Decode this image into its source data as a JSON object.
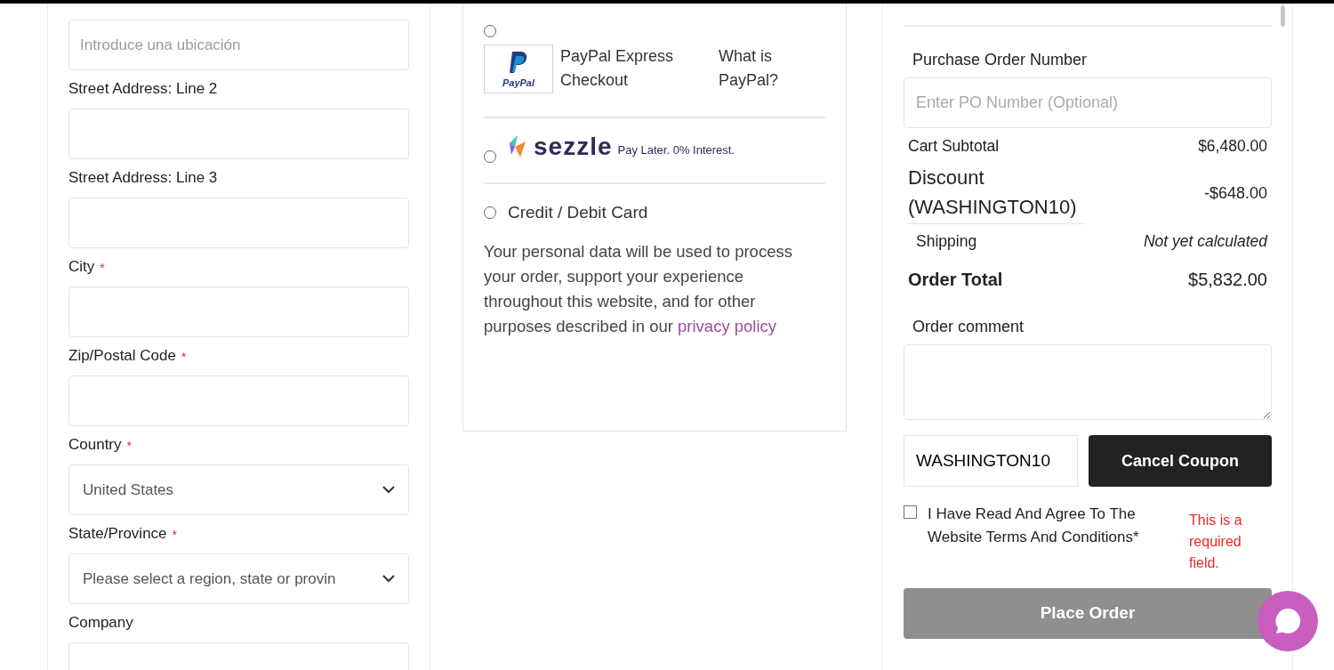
{
  "address_form": {
    "location_field": {
      "placeholder": "Introduce una ubicación"
    },
    "fields": [
      {
        "label": "Street Address: Line 2",
        "kind": "text"
      },
      {
        "label": "Street Address: Line 3",
        "kind": "text"
      },
      {
        "label": "City",
        "required_mark": "*",
        "kind": "text"
      },
      {
        "label": "Zip/Postal Code",
        "required_mark": "*",
        "kind": "text"
      },
      {
        "label": "Country",
        "required_mark": "*",
        "kind": "select",
        "value": "United States"
      },
      {
        "label": "State/Province",
        "required_mark": "*",
        "kind": "select",
        "value": "Please select a region, state or provin"
      },
      {
        "label": "Company",
        "kind": "text"
      }
    ]
  },
  "payment_methods": [
    {
      "kind": "paypal",
      "selected": false,
      "logo_text": "PayPal",
      "label": "PayPal Express Checkout",
      "link": "What is PayPal?"
    },
    {
      "kind": "sezzle",
      "selected": false,
      "logo_text": "sezzle",
      "tagline": "Pay Later. 0% Interest."
    },
    {
      "kind": "card",
      "selected": false,
      "label": "Credit / Debit Card"
    }
  ],
  "privacy_notice": {
    "text": "Your personal data will be used to process your order, support your experience throughout this website, and for other purposes described in our",
    "link": "privacy policy"
  },
  "summary": {
    "po_label": "Purchase Order Number",
    "po_placeholder": "Enter PO Number (Optional)",
    "totals": [
      {
        "kind": "subtotal",
        "label": "Cart Subtotal",
        "value": "$6,480.00"
      },
      {
        "kind": "discount",
        "label": "Discount (WASHINGTON10)",
        "value": "-$648.00"
      },
      {
        "kind": "shipping",
        "label": "Shipping",
        "value": "Not yet calculated"
      },
      {
        "kind": "total",
        "label": "Order Total",
        "value": "$5,832.00"
      }
    ],
    "comment_label": "Order comment",
    "coupon_value": "WASHINGTON10",
    "coupon_button": "Cancel Coupon",
    "terms": {
      "checked": false,
      "label": "I Have Read And Agree To The Website Terms And Conditions*",
      "error": "This is a required field."
    },
    "place_order": {
      "label": "Place Order",
      "disabled": true
    }
  }
}
